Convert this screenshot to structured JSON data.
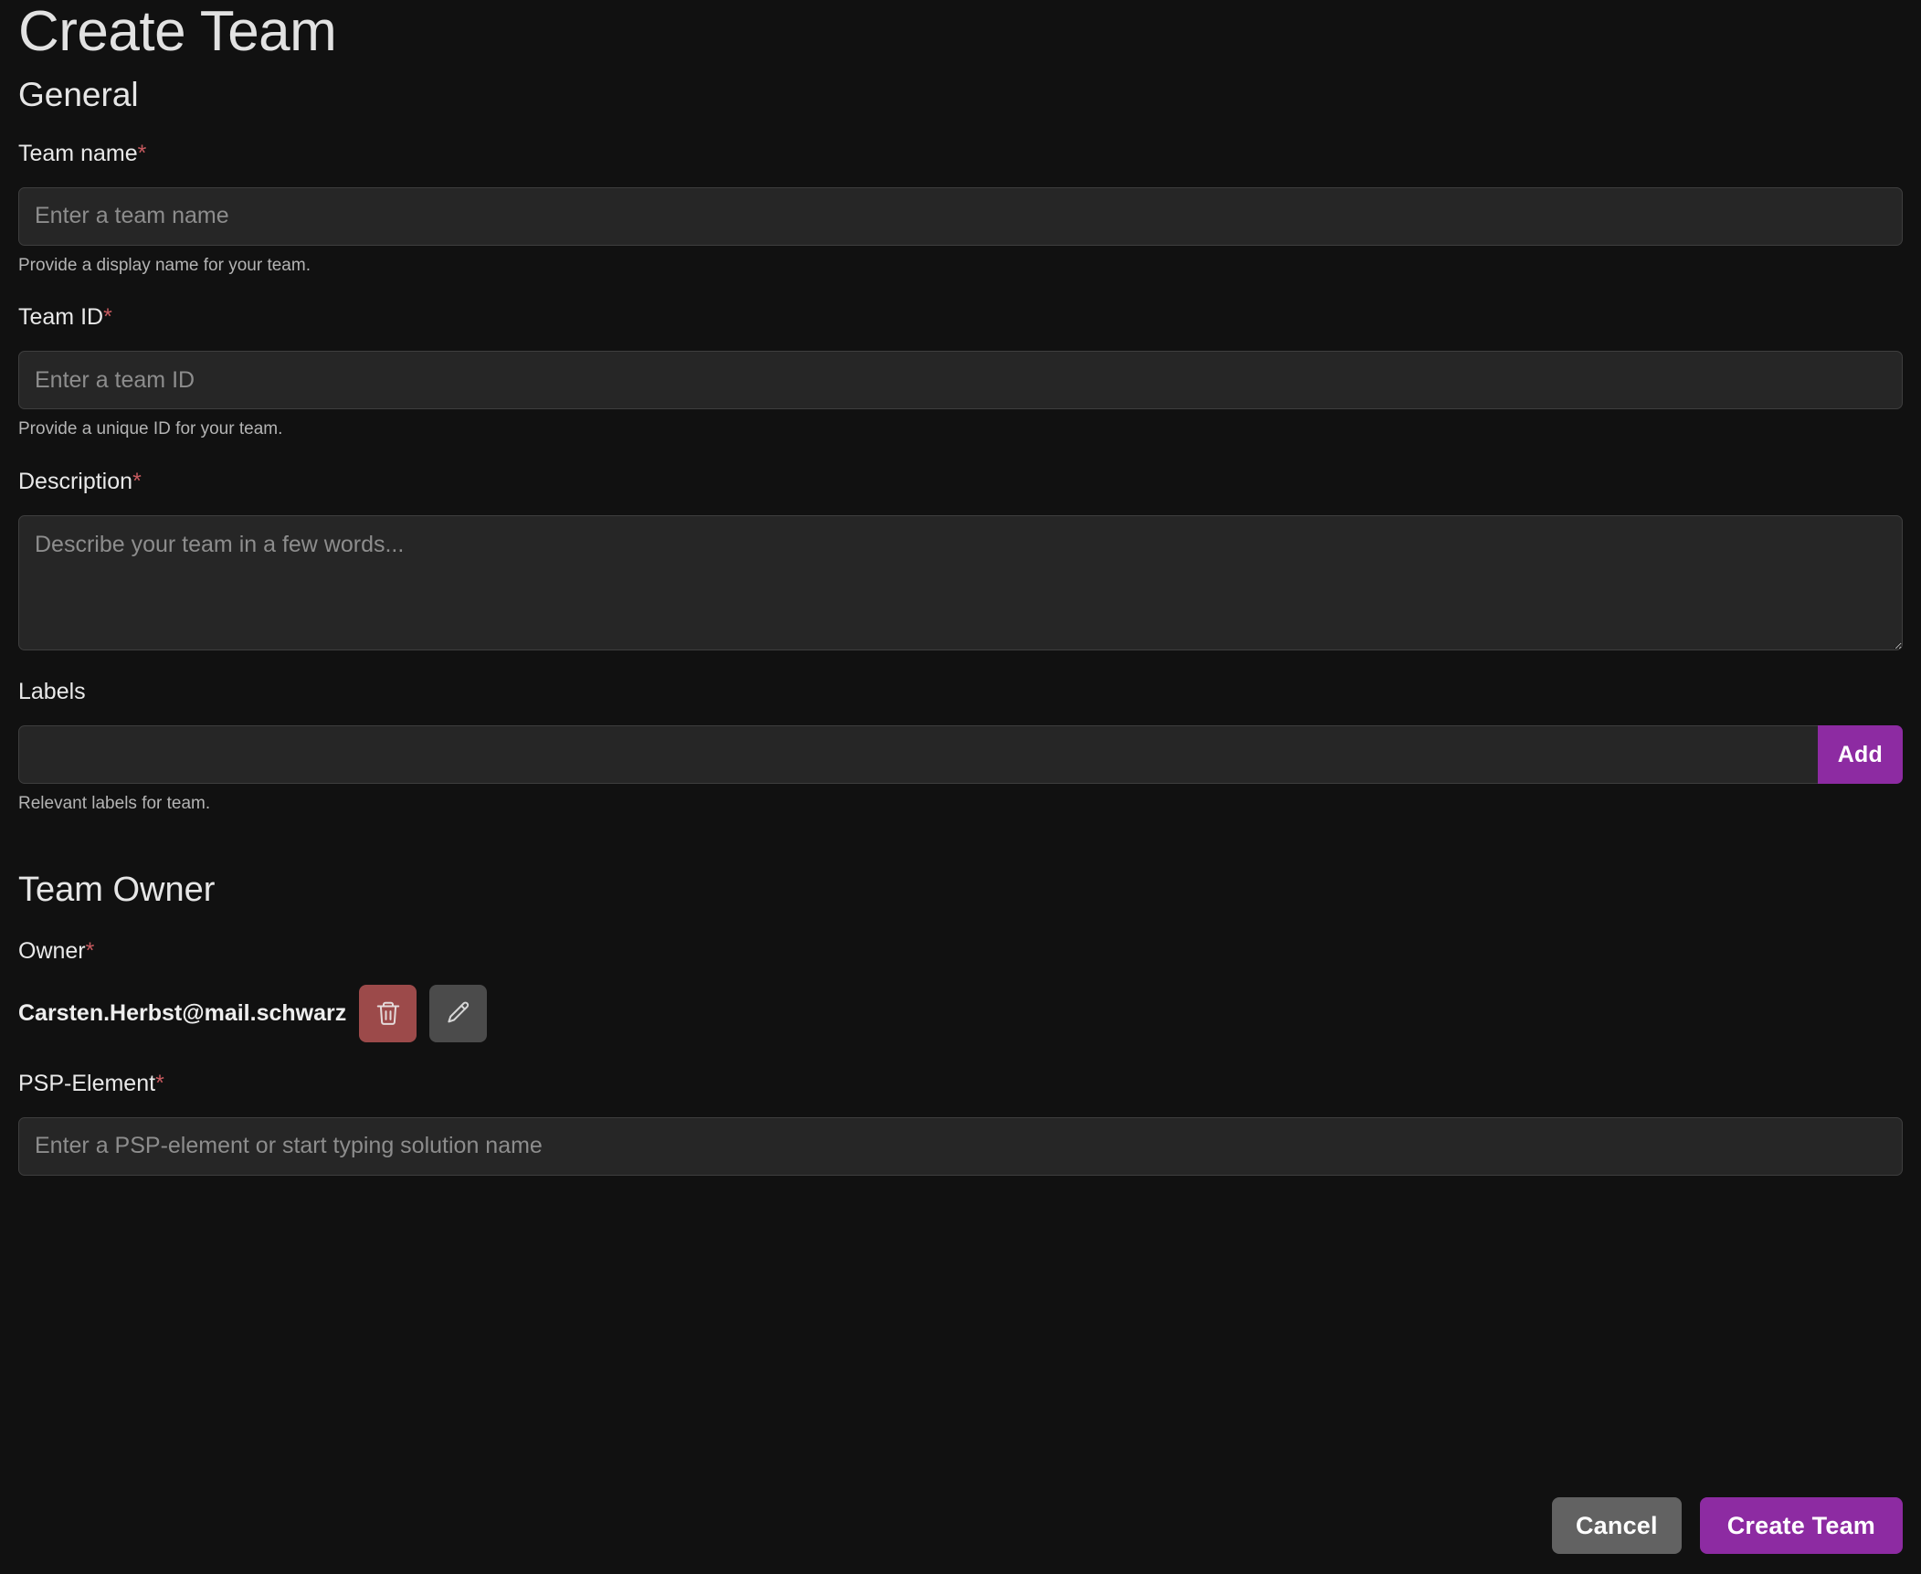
{
  "page": {
    "title": "Create Team"
  },
  "general": {
    "section_title": "General",
    "team_name": {
      "label": "Team name",
      "required_mark": "*",
      "placeholder": "Enter a team name",
      "value": "",
      "help": "Provide a display name for your team."
    },
    "team_id": {
      "label": "Team ID",
      "required_mark": "*",
      "placeholder": "Enter a team ID",
      "value": "",
      "help": "Provide a unique ID for your team."
    },
    "description": {
      "label": "Description",
      "required_mark": "*",
      "placeholder": "Describe your team in a few words...",
      "value": ""
    },
    "labels": {
      "label": "Labels",
      "placeholder": "",
      "value": "",
      "add_button": "Add",
      "help": "Relevant labels for team."
    }
  },
  "team_owner": {
    "section_title": "Team Owner",
    "owner": {
      "label": "Owner",
      "required_mark": "*",
      "email": "Carsten.Herbst@mail.schwarz",
      "delete_icon": "trash-icon",
      "edit_icon": "pencil-icon"
    },
    "psp_element": {
      "label": "PSP-Element",
      "required_mark": "*",
      "placeholder": "Enter a PSP-element or start typing solution name",
      "value": ""
    }
  },
  "footer": {
    "cancel_label": "Cancel",
    "submit_label": "Create Team"
  },
  "colors": {
    "background": "#111111",
    "input_background": "#262626",
    "input_border": "#3e3e3e",
    "accent_purple": "#8d2ba2",
    "cancel_gray": "#626262",
    "delete_red": "#9c4a4a",
    "edit_gray": "#4b4b4b",
    "required_red": "#c65a5f",
    "help_text": "#b4b4b4",
    "placeholder": "#8d8d8d"
  }
}
